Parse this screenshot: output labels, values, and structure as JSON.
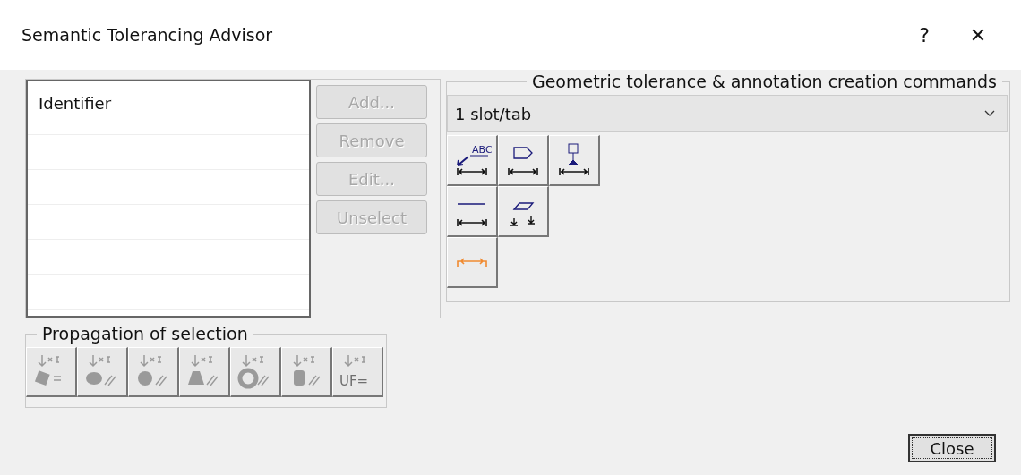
{
  "window": {
    "title": "Semantic Tolerancing Advisor",
    "help": "?",
    "close": "✕"
  },
  "list": {
    "header": "Identifier"
  },
  "list_buttons": [
    {
      "label": "Add...",
      "disabled": true
    },
    {
      "label": "Remove",
      "disabled": true
    },
    {
      "label": "Edit...",
      "disabled": true
    },
    {
      "label": "Unselect",
      "disabled": true
    }
  ],
  "commands": {
    "title": "Geometric tolerance & annotation creation commands",
    "dropdown": "1 slot/tab",
    "tools": [
      [
        {
          "kind": "text",
          "label": "ABC"
        },
        {
          "kind": "flag"
        },
        {
          "kind": "datum"
        }
      ],
      [
        {
          "kind": "line"
        },
        {
          "kind": "flatness"
        }
      ],
      [
        {
          "kind": "dimension"
        }
      ]
    ]
  },
  "propagation": {
    "title": "Propagation of selection",
    "buttons": [
      {
        "kind": "plane",
        "disabled": true
      },
      {
        "kind": "cylinder",
        "disabled": true
      },
      {
        "kind": "sphere",
        "disabled": true
      },
      {
        "kind": "cone",
        "disabled": true
      },
      {
        "kind": "torus",
        "disabled": true
      },
      {
        "kind": "pattern",
        "disabled": true
      },
      {
        "kind": "uf",
        "label": "UF=",
        "disabled": true
      }
    ]
  },
  "close_button": "Close"
}
